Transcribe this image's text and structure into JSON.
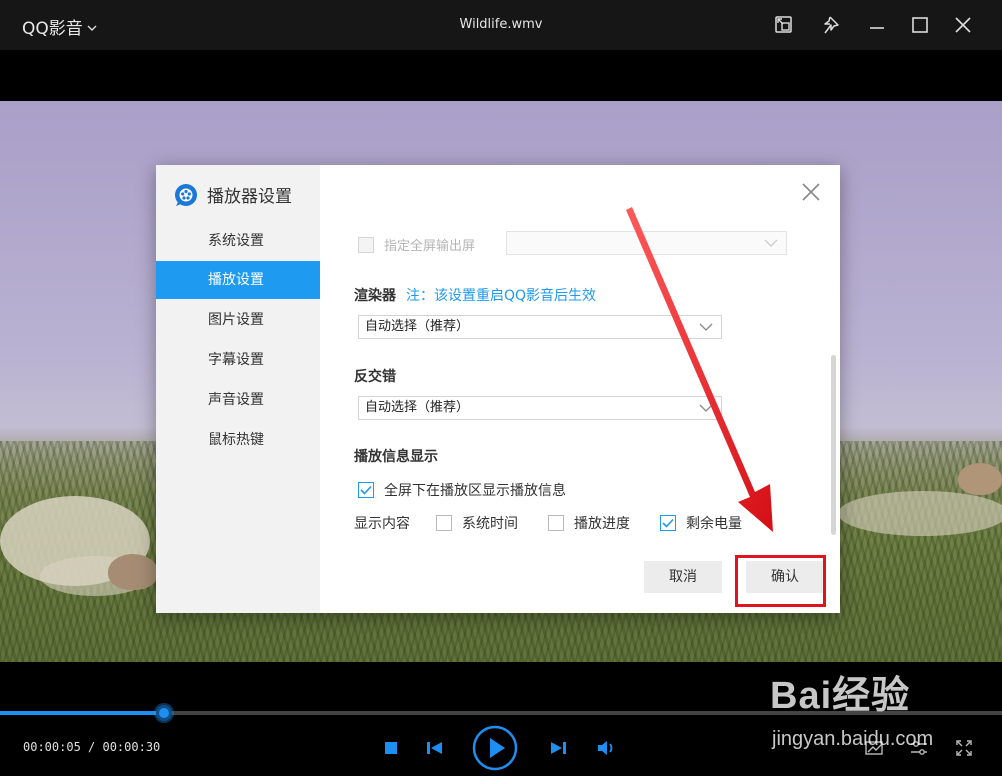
{
  "titlebar": {
    "app_name": "QQ影音",
    "file_title": "Wildlife.wmv"
  },
  "dialog": {
    "title": "播放器设置",
    "sidebar": [
      {
        "label": "系统设置"
      },
      {
        "label": "播放设置",
        "active": true
      },
      {
        "label": "图片设置"
      },
      {
        "label": "字幕设置"
      },
      {
        "label": "声音设置"
      },
      {
        "label": "鼠标热键"
      }
    ],
    "fullscreen_output": {
      "label": "指定全屏输出屏",
      "checked": false,
      "disabled": true,
      "selected": ""
    },
    "renderer": {
      "label": "渲染器",
      "note": "注：该设置重启QQ影音后生效",
      "selected": "自动选择（推荐）"
    },
    "deinterlace": {
      "label": "反交错",
      "selected": "自动选择（推荐）"
    },
    "playback_info": {
      "label": "播放信息显示",
      "show_in_fullscreen": {
        "label": "全屏下在播放区显示播放信息",
        "checked": true
      },
      "content_label": "显示内容",
      "options": [
        {
          "label": "系统时间",
          "checked": false
        },
        {
          "label": "播放进度",
          "checked": false
        },
        {
          "label": "剩余电量",
          "checked": true
        }
      ]
    },
    "cancel_label": "取消",
    "confirm_label": "确认"
  },
  "player": {
    "time_display": "00:00:05 / 00:00:30",
    "progress": 0.1667,
    "accent_color": "#1e8ff0"
  },
  "watermark": {
    "brand": "Bai经验",
    "url": "jingyan.baidu.com"
  }
}
